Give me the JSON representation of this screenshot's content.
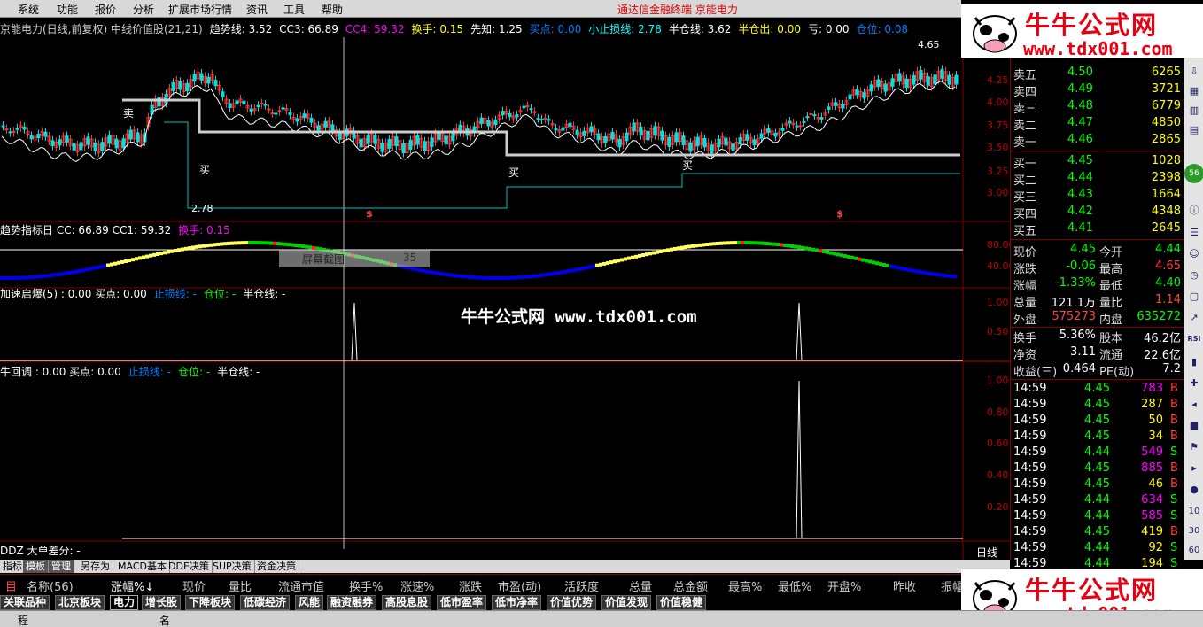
{
  "menu": {
    "items": [
      "系统",
      "功能",
      "报价",
      "分析",
      "扩展市场行情",
      "资讯",
      "工具",
      "帮助"
    ],
    "center_title": "通达信金融终端   京能电力"
  },
  "logo": {
    "title": "牛牛公式网",
    "url": "www.tdx001.com"
  },
  "watermark": "牛牛公式网 www.tdx001.com",
  "main_header": [
    {
      "t": "京能电力(日线,前复权) 中线价值股(21,21)",
      "c": "#cccccc"
    },
    {
      "t": "趋势线: 3.52",
      "c": "#ffffff"
    },
    {
      "t": "CC3: 66.89",
      "c": "#ffffff"
    },
    {
      "t": "CC4: 59.32",
      "c": "#ff00ff"
    },
    {
      "t": "换手: 0.15",
      "c": "#ffff00"
    },
    {
      "t": "先知: 1.25",
      "c": "#ffffff"
    },
    {
      "t": "买点: 0.00",
      "c": "#0080ff"
    },
    {
      "t": "小止损线: 2.78",
      "c": "#00ffff"
    },
    {
      "t": "半仓线: 3.62",
      "c": "#ffffff"
    },
    {
      "t": "半仓出: 0.00",
      "c": "#ffff00"
    },
    {
      "t": "亏: 0.00",
      "c": "#ffffff"
    },
    {
      "t": "仓位: 0.08",
      "c": "#0080ff"
    }
  ],
  "sub1_header": [
    {
      "t": "趋势指标日  CC: 66.89  CC1: 59.32",
      "c": "#ffffff"
    },
    {
      "t": "换手: 0.15",
      "c": "#ff00ff"
    }
  ],
  "sub2_header": [
    {
      "t": "加速启爆(5) : 0.00  买点: 0.00",
      "c": "#ffffff"
    },
    {
      "t": "止损线: -",
      "c": "#0080ff"
    },
    {
      "t": "仓位: -",
      "c": "#00ff00"
    },
    {
      "t": "半仓线: -",
      "c": "#ffffff"
    }
  ],
  "sub3_header": [
    {
      "t": "牛回调 : 0.00  买点: 0.00",
      "c": "#ffffff"
    },
    {
      "t": "止损线: -",
      "c": "#0080ff"
    },
    {
      "t": "仓位: -",
      "c": "#00ff00"
    },
    {
      "t": "半仓线: -",
      "c": "#ffffff"
    }
  ],
  "sub4_header": "DDZ 大单差分: -",
  "screenshot_tip": "屏幕截图",
  "screenshot_num": "35",
  "marker_buy": "买",
  "marker_sell": "卖",
  "marker_dollar": "$",
  "peak_label": "4.65",
  "low_label": "2.78",
  "period_label": "日线",
  "price_axis": [
    "4.25",
    "4.00",
    "3.75",
    "3.50",
    "3.25",
    "3.00"
  ],
  "sub1_axis": [
    "80.00",
    "40.00"
  ],
  "sub2_axis": [
    "1.00",
    "0.50"
  ],
  "sub3_axis": [
    "1.00",
    "0.80",
    "0.60",
    "0.40",
    "0.20"
  ],
  "quote": {
    "asks": [
      {
        "label": "卖五",
        "price": "4.50",
        "vol": "6265"
      },
      {
        "label": "卖四",
        "price": "4.49",
        "vol": "3721"
      },
      {
        "label": "卖三",
        "price": "4.48",
        "vol": "6779"
      },
      {
        "label": "卖二",
        "price": "4.47",
        "vol": "4850"
      },
      {
        "label": "卖一",
        "price": "4.46",
        "vol": "2865"
      }
    ],
    "bids": [
      {
        "label": "买一",
        "price": "4.45",
        "vol": "1028"
      },
      {
        "label": "买二",
        "price": "4.44",
        "vol": "2398"
      },
      {
        "label": "买三",
        "price": "4.43",
        "vol": "1664"
      },
      {
        "label": "买四",
        "price": "4.42",
        "vol": "4348"
      },
      {
        "label": "买五",
        "price": "4.41",
        "vol": "2645"
      }
    ],
    "stats": [
      {
        "l1": "现价",
        "v1": "4.45",
        "c1": "#00ff00",
        "l2": "今开",
        "v2": "4.44",
        "c2": "#00ff00"
      },
      {
        "l1": "涨跌",
        "v1": "-0.06",
        "c1": "#00ff00",
        "l2": "最高",
        "v2": "4.65",
        "c2": "#ff4040"
      },
      {
        "l1": "涨幅",
        "v1": "-1.33%",
        "c1": "#00ff00",
        "l2": "最低",
        "v2": "4.40",
        "c2": "#00ff00"
      },
      {
        "l1": "总量",
        "v1": "121.1万",
        "c1": "#ffffff",
        "l2": "量比",
        "v2": "1.14",
        "c2": "#ff4040"
      },
      {
        "l1": "外盘",
        "v1": "575273",
        "c1": "#ff4040",
        "l2": "内盘",
        "v2": "635272",
        "c2": "#00ff00"
      }
    ],
    "fund": [
      {
        "l1": "换手",
        "v1": "5.36%",
        "l2": "股本",
        "v2": "46.2亿"
      },
      {
        "l1": "净资",
        "v1": "3.11",
        "l2": "流通",
        "v2": "22.6亿"
      },
      {
        "l1": "收益(三)",
        "v1": "0.464",
        "l2": "PE(动)",
        "v2": "7.2"
      }
    ],
    "ticks": [
      {
        "time": "14:59",
        "price": "4.45",
        "vol": "783",
        "vc": "#ff00ff",
        "bs": "B",
        "bc": "#ff4040"
      },
      {
        "time": "14:59",
        "price": "4.45",
        "vol": "287",
        "vc": "#ffff00",
        "bs": "B",
        "bc": "#ff4040"
      },
      {
        "time": "14:59",
        "price": "4.45",
        "vol": "50",
        "vc": "#ffff00",
        "bs": "B",
        "bc": "#ff4040"
      },
      {
        "time": "14:59",
        "price": "4.45",
        "vol": "34",
        "vc": "#ffff00",
        "bs": "B",
        "bc": "#ff4040"
      },
      {
        "time": "14:59",
        "price": "4.44",
        "vol": "549",
        "vc": "#ff00ff",
        "bs": "S",
        "bc": "#00ff00"
      },
      {
        "time": "14:59",
        "price": "4.45",
        "vol": "885",
        "vc": "#ff00ff",
        "bs": "B",
        "bc": "#ff4040"
      },
      {
        "time": "14:59",
        "price": "4.45",
        "vol": "46",
        "vc": "#ffff00",
        "bs": "B",
        "bc": "#ff4040"
      },
      {
        "time": "14:59",
        "price": "4.44",
        "vol": "634",
        "vc": "#ff00ff",
        "bs": "S",
        "bc": "#00ff00"
      },
      {
        "time": "14:59",
        "price": "4.44",
        "vol": "585",
        "vc": "#ff00ff",
        "bs": "S",
        "bc": "#00ff00"
      },
      {
        "time": "14:59",
        "price": "4.45",
        "vol": "419",
        "vc": "#ffff00",
        "bs": "B",
        "bc": "#ff4040"
      },
      {
        "time": "14:59",
        "price": "4.44",
        "vol": "92",
        "vc": "#ffff00",
        "bs": "S",
        "bc": "#00ff00"
      },
      {
        "time": "14:59",
        "price": "4.44",
        "vol": "194",
        "vc": "#ffff00",
        "bs": "S",
        "bc": "#00ff00"
      }
    ]
  },
  "lower_tabs": [
    "指标",
    "模板",
    "管理",
    "另存为",
    "MACD基本",
    "DDE决策",
    "SUP决策",
    "资金决策"
  ],
  "list_header": [
    "名称(56)",
    "涨幅%↓",
    "现价",
    "量比",
    "流通市值",
    "换手%",
    "涨速%",
    "涨跌",
    "市盈(动)",
    "活跃度",
    "总量",
    "总金额",
    "最高%",
    "最低%",
    "开盘%",
    "昨收",
    "振幅"
  ],
  "cat_tabs": [
    "关联品种",
    "北京板块",
    "电力",
    "增长股",
    "下降板块",
    "低碳经济",
    "风能",
    "融资融券",
    "高股息股",
    "低市盈率",
    "低市净率",
    "价值优势",
    "价值发现",
    "价值稳健"
  ],
  "active_cat": "电力",
  "status": [
    "程",
    "名"
  ]
}
